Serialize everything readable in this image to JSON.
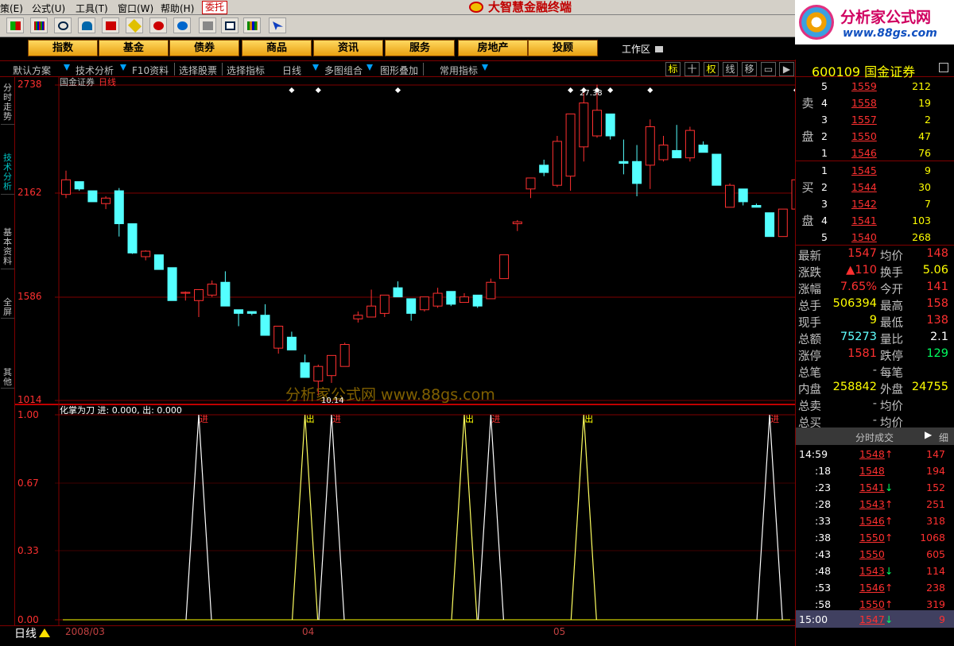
{
  "menubar": {
    "items": [
      "策(E)",
      "公式(U)",
      "工具(T)",
      "窗口(W)",
      "帮助(H)"
    ],
    "entrust": "委托",
    "app_title": "大智慧金融终端"
  },
  "brand": {
    "line1": "分析家公式网",
    "line2": "www.88gs.com"
  },
  "nav": {
    "buttons": [
      "指数",
      "基金",
      "债券",
      "商品",
      "资讯",
      "服务",
      "房地产",
      "投顾"
    ],
    "workarea": "工作区"
  },
  "subbar": {
    "items": [
      "默认方案",
      "技术分析",
      "F10资料",
      "选择股票",
      "选择指标",
      "日线",
      "多图组合",
      "图形叠加",
      "常用指标"
    ],
    "right_tabs": [
      "标",
      "十",
      "权",
      "线",
      "移"
    ]
  },
  "left_tabs": [
    "分时走势",
    "技术分析",
    "基本资料",
    "全屏",
    "其他"
  ],
  "chart": {
    "stock_label": "国金证券",
    "period_label": "日线",
    "y_ticks": [
      "2738",
      "2162",
      "1586",
      "1014"
    ],
    "peak_label": "27.38",
    "low_label": "10.14",
    "watermark": "分析家公式网 www.88gs.com",
    "indicator_label": "化掌为刀 进: 0.000, 出: 0.000",
    "ind_ticks": [
      "1.00",
      "0.67",
      "0.33",
      "0.00"
    ],
    "date_labels": [
      "2008/03",
      "04",
      "05"
    ],
    "day_line": "日线",
    "signal_words": {
      "in": "进",
      "out": "出"
    }
  },
  "chart_data": [
    {
      "type": "candlestick",
      "title": "国金证券 日线",
      "ylim": [
        1014,
        2738
      ],
      "y_ticks": [
        2738,
        2162,
        1586,
        1014
      ],
      "x_labels": [
        "2008/03",
        "04",
        "05"
      ],
      "annotations": [
        {
          "text": "27.38",
          "kind": "high"
        },
        {
          "text": "10.14",
          "kind": "low"
        }
      ],
      "candles": [
        {
          "o": 2140,
          "h": 2270,
          "l": 2120,
          "c": 2220
        },
        {
          "o": 2210,
          "h": 2210,
          "l": 2160,
          "c": 2170
        },
        {
          "o": 2160,
          "h": 2160,
          "l": 2100,
          "c": 2100
        },
        {
          "o": 2090,
          "h": 2130,
          "l": 2060,
          "c": 2120
        },
        {
          "o": 2160,
          "h": 2175,
          "l": 1910,
          "c": 1980
        },
        {
          "o": 1980,
          "h": 1980,
          "l": 1815,
          "c": 1820
        },
        {
          "o": 1800,
          "h": 1835,
          "l": 1780,
          "c": 1830
        },
        {
          "o": 1810,
          "h": 1810,
          "l": 1730,
          "c": 1730
        },
        {
          "o": 1740,
          "h": 1740,
          "l": 1560,
          "c": 1560
        },
        {
          "o": 1600,
          "h": 1610,
          "l": 1560,
          "c": 1605
        },
        {
          "o": 1560,
          "h": 1620,
          "l": 1470,
          "c": 1620
        },
        {
          "o": 1590,
          "h": 1670,
          "l": 1580,
          "c": 1650
        },
        {
          "o": 1660,
          "h": 1720,
          "l": 1530,
          "c": 1530
        },
        {
          "o": 1510,
          "h": 1510,
          "l": 1420,
          "c": 1490
        },
        {
          "o": 1500,
          "h": 1500,
          "l": 1480,
          "c": 1490
        },
        {
          "o": 1480,
          "h": 1540,
          "l": 1370,
          "c": 1370
        },
        {
          "o": 1300,
          "h": 1420,
          "l": 1270,
          "c": 1420
        },
        {
          "o": 1360,
          "h": 1390,
          "l": 1290,
          "c": 1290
        },
        {
          "o": 1220,
          "h": 1265,
          "l": 1140,
          "c": 1140
        },
        {
          "o": 1120,
          "h": 1210,
          "l": 1040,
          "c": 1200
        },
        {
          "o": 1150,
          "h": 1260,
          "l": 1110,
          "c": 1260
        },
        {
          "o": 1200,
          "h": 1330,
          "l": 1210,
          "c": 1320
        },
        {
          "o": 1460,
          "h": 1500,
          "l": 1440,
          "c": 1480
        },
        {
          "o": 1470,
          "h": 1620,
          "l": 1470,
          "c": 1530
        },
        {
          "o": 1490,
          "h": 1590,
          "l": 1470,
          "c": 1590
        },
        {
          "o": 1630,
          "h": 1665,
          "l": 1590,
          "c": 1580
        },
        {
          "o": 1570,
          "h": 1570,
          "l": 1450,
          "c": 1490
        },
        {
          "o": 1510,
          "h": 1580,
          "l": 1500,
          "c": 1580
        },
        {
          "o": 1530,
          "h": 1630,
          "l": 1520,
          "c": 1600
        },
        {
          "o": 1610,
          "h": 1610,
          "l": 1530,
          "c": 1540
        },
        {
          "o": 1550,
          "h": 1600,
          "l": 1550,
          "c": 1580
        },
        {
          "o": 1590,
          "h": 1590,
          "l": 1520,
          "c": 1530
        },
        {
          "o": 1570,
          "h": 1680,
          "l": 1570,
          "c": 1660
        },
        {
          "o": 1680,
          "h": 1810,
          "l": 1680,
          "c": 1810
        },
        {
          "o": 1980,
          "h": 2000,
          "l": 1940,
          "c": 1990
        },
        {
          "o": 2170,
          "h": 2220,
          "l": 2120,
          "c": 2230
        },
        {
          "o": 2300,
          "h": 2330,
          "l": 2240,
          "c": 2260
        },
        {
          "o": 2190,
          "h": 2460,
          "l": 2180,
          "c": 2430
        },
        {
          "o": 2240,
          "h": 2580,
          "l": 2160,
          "c": 2580
        },
        {
          "o": 2400,
          "h": 2700,
          "l": 2320,
          "c": 2640
        },
        {
          "o": 2460,
          "h": 2740,
          "l": 2450,
          "c": 2600
        },
        {
          "o": 2580,
          "h": 2580,
          "l": 2440,
          "c": 2460
        },
        {
          "o": 2320,
          "h": 2440,
          "l": 2250,
          "c": 2310
        },
        {
          "o": 2320,
          "h": 2410,
          "l": 2130,
          "c": 2200
        },
        {
          "o": 2300,
          "h": 2550,
          "l": 2170,
          "c": 2510
        },
        {
          "o": 2330,
          "h": 2460,
          "l": 2320,
          "c": 2410
        },
        {
          "o": 2380,
          "h": 2520,
          "l": 2350,
          "c": 2340
        },
        {
          "o": 2340,
          "h": 2510,
          "l": 2320,
          "c": 2490
        },
        {
          "o": 2410,
          "h": 2430,
          "l": 2370,
          "c": 2370
        },
        {
          "o": 2360,
          "h": 2360,
          "l": 2190,
          "c": 2190
        },
        {
          "o": 2070,
          "h": 2200,
          "l": 2070,
          "c": 2190
        },
        {
          "o": 2170,
          "h": 2170,
          "l": 2080,
          "c": 2100
        },
        {
          "o": 2080,
          "h": 2090,
          "l": 2070,
          "c": 2070
        },
        {
          "o": 2040,
          "h": 2040,
          "l": 1910,
          "c": 1910
        },
        {
          "o": 1910,
          "h": 2060,
          "l": 1910,
          "c": 2060
        },
        {
          "o": 2060,
          "h": 2240,
          "l": 2030,
          "c": 2220
        },
        {
          "o": 2230,
          "h": 2480,
          "l": 2230,
          "c": 2410
        }
      ]
    },
    {
      "type": "line",
      "title": "化掌为刀",
      "ylim": [
        0,
        1
      ],
      "y_ticks": [
        1.0,
        0.67,
        0.33,
        0.0
      ],
      "series": [
        {
          "name": "进",
          "values": [
            0,
            0
          ]
        },
        {
          "name": "出",
          "values": [
            0,
            0
          ]
        }
      ],
      "signals": [
        {
          "candle": 10,
          "kind": "进"
        },
        {
          "candle": 18,
          "kind": "出"
        },
        {
          "candle": 20,
          "kind": "进"
        },
        {
          "candle": 30,
          "kind": "出"
        },
        {
          "candle": 32,
          "kind": "进"
        },
        {
          "candle": 39,
          "kind": "出"
        },
        {
          "candle": 53,
          "kind": "进"
        }
      ]
    }
  ],
  "orderbook": {
    "code": "600109",
    "name": "国金证券",
    "sell_label": [
      "卖",
      "盘"
    ],
    "buy_label": [
      "买",
      "盘"
    ],
    "sell": [
      {
        "lvl": "5",
        "price": "1559",
        "vol": "212"
      },
      {
        "lvl": "4",
        "price": "1558",
        "vol": "19"
      },
      {
        "lvl": "3",
        "price": "1557",
        "vol": "2"
      },
      {
        "lvl": "2",
        "price": "1550",
        "vol": "47"
      },
      {
        "lvl": "1",
        "price": "1546",
        "vol": "76"
      }
    ],
    "buy": [
      {
        "lvl": "1",
        "price": "1545",
        "vol": "9"
      },
      {
        "lvl": "2",
        "price": "1544",
        "vol": "30"
      },
      {
        "lvl": "3",
        "price": "1542",
        "vol": "7"
      },
      {
        "lvl": "4",
        "price": "1541",
        "vol": "103"
      },
      {
        "lvl": "5",
        "price": "1540",
        "vol": "268"
      }
    ]
  },
  "quote": [
    {
      "k1": "最新",
      "v1": "1547",
      "c1": "num-r",
      "k2": "均价",
      "v2": "148",
      "c2": "num-r"
    },
    {
      "k1": "涨跌",
      "v1": "▲110",
      "c1": "num-r",
      "k2": "换手",
      "v2": "5.06",
      "c2": "num-y"
    },
    {
      "k1": "涨幅",
      "v1": "7.65%",
      "c1": "num-r",
      "k2": "今开",
      "v2": "141",
      "c2": "num-r"
    },
    {
      "k1": "总手",
      "v1": "506394",
      "c1": "num-y",
      "k2": "最高",
      "v2": "158",
      "c2": "num-r"
    },
    {
      "k1": "现手",
      "v1": "9",
      "c1": "num-y",
      "k2": "最低",
      "v2": "138",
      "c2": "num-r"
    },
    {
      "k1": "总额",
      "v1": "75273",
      "c1": "num-c",
      "k2": "量比",
      "v2": "2.1",
      "c2": "num-w"
    },
    {
      "k1": "涨停",
      "v1": "1581",
      "c1": "num-r",
      "k2": "跌停",
      "v2": "129",
      "c2": "num-g"
    },
    {
      "k1": "总笔",
      "v1": "-",
      "c1": "num-gy",
      "k2": "每笔",
      "v2": "",
      "c2": "num-gy"
    },
    {
      "k1": "内盘",
      "v1": "258842",
      "c1": "num-y",
      "k2": "外盘",
      "v2": "24755",
      "c2": "num-y"
    },
    {
      "k1": "总卖",
      "v1": "-",
      "c1": "num-gy",
      "k2": "均价",
      "v2": "",
      "c2": "num-gy"
    },
    {
      "k1": "总买",
      "v1": "-",
      "c1": "num-gy",
      "k2": "均价",
      "v2": "",
      "c2": "num-gy"
    }
  ],
  "trades": {
    "header": "分时成交",
    "header_right": "细",
    "rows": [
      {
        "t": "14:59",
        "p": "1548",
        "d": "up",
        "v": "147"
      },
      {
        "t": ":18",
        "p": "1548",
        "d": "",
        "v": "194"
      },
      {
        "t": ":23",
        "p": "1541",
        "d": "down",
        "v": "152"
      },
      {
        "t": ":28",
        "p": "1543",
        "d": "up",
        "v": "251"
      },
      {
        "t": ":33",
        "p": "1546",
        "d": "up",
        "v": "318"
      },
      {
        "t": ":38",
        "p": "1550",
        "d": "up",
        "v": "1068"
      },
      {
        "t": ":43",
        "p": "1550",
        "d": "",
        "v": "605"
      },
      {
        "t": ":48",
        "p": "1543",
        "d": "down",
        "v": "114"
      },
      {
        "t": ":53",
        "p": "1546",
        "d": "up",
        "v": "238"
      },
      {
        "t": ":58",
        "p": "1550",
        "d": "up",
        "v": "319"
      },
      {
        "t": "15:00",
        "p": "1547",
        "d": "down",
        "v": "9"
      }
    ]
  }
}
